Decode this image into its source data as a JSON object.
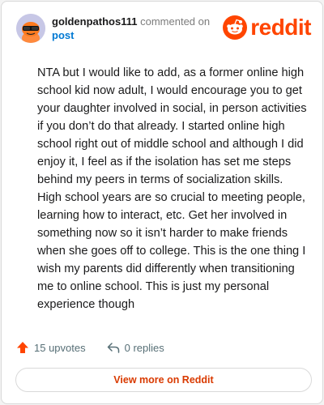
{
  "comment": {
    "username": "goldenpathos111",
    "action_text": "commented on",
    "post_link": "post",
    "body": "NTA but I would like to add, as a former online high school kid now adult, I would encourage you to get your daughter involved in social, in person activities if you don’t do that already. I started online high school right out of middle school and although I did enjoy it, I feel as if the isolation has set me steps behind my peers in terms of socialization skills. High school years are so crucial to meeting people, learning how to interact, etc. Get her involved in something now so it isn’t harder to make friends when she goes off to college. This is the one thing I wish my parents did differently when transitioning me to online school. This is just my personal experience though"
  },
  "brand": {
    "name": "reddit",
    "color": "#ff4500"
  },
  "stats": {
    "upvotes": "15 upvotes",
    "replies": "0 replies"
  },
  "footer": {
    "view_more_label": "View more on Reddit"
  },
  "icons": {
    "avatar": "avatar-snoo-sunglasses",
    "logo": "reddit-snoo-icon",
    "upvote": "upvote-arrow-icon",
    "reply": "reply-arrow-icon"
  },
  "colors": {
    "accent": "#ff4500",
    "link": "#0079d3",
    "button_text": "#d93a00"
  }
}
